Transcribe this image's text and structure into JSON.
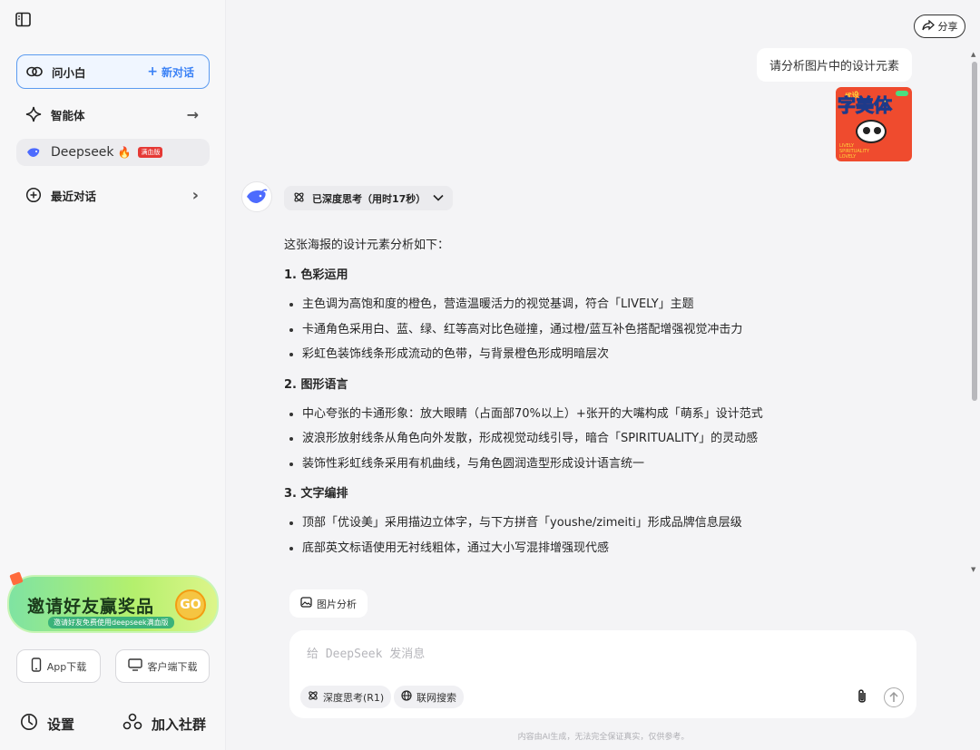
{
  "sidebar": {
    "ask_label": "问小白",
    "new_chat_label": "新对话",
    "agents_label": "智能体",
    "deepseek_label": "Deepseek",
    "deepseek_badge": "满血版",
    "recent_label": "最近对话",
    "promo_title": "邀请好友赢奖品",
    "promo_sub": "邀请好友免费使用deepseek满血版",
    "promo_go": "GO",
    "app_download": "App下载",
    "client_download": "客户端下载",
    "settings_label": "设置",
    "community_label": "加入社群"
  },
  "header": {
    "share_label": "分享"
  },
  "conversation": {
    "user_message": "请分析图片中的设计元素",
    "user_image": {
      "line1": "优设",
      "line2": "字美体",
      "line3": "LIVELY SPIRITUALITY LOVELY"
    },
    "think_label": "已深度思考（用时17秒）",
    "intro": "这张海报的设计元素分析如下：",
    "sections": [
      {
        "title": "1. 色彩运用",
        "items": [
          "主色调为高饱和度的橙色，营造温暖活力的视觉基调，符合「LIVELY」主题",
          "卡通角色采用白、蓝、绿、红等高对比色碰撞，通过橙/蓝互补色搭配增强视觉冲击力",
          "彩虹色装饰线条形成流动的色带，与背景橙色形成明暗层次"
        ]
      },
      {
        "title": "2. 图形语言",
        "items": [
          "中心夸张的卡通形象：放大眼睛（占面部70%以上）+张开的大嘴构成「萌系」设计范式",
          "波浪形放射线条从角色向外发散，形成视觉动线引导，暗合「SPIRITUALITY」的灵动感",
          "装饰性彩虹线条采用有机曲线，与角色圆润造型形成设计语言统一"
        ]
      },
      {
        "title": "3. 文字编排",
        "items": [
          "顶部「优设美」采用描边立体字，与下方拼音「youshe/zimeiti」形成品牌信息层级",
          "底部英文标语使用无衬线粗体，通过大小写混排增强现代感"
        ]
      }
    ]
  },
  "composer": {
    "chip_label": "图片分析",
    "placeholder": "给 DeepSeek 发消息",
    "deep_think_label": "深度思考(R1)",
    "web_search_label": "联网搜索"
  },
  "footer": {
    "disclaimer": "内容由AI生成，无法完全保证真实，仅供参考。"
  },
  "colors": {
    "accent": "#3b82f6",
    "active_border": "#5b9bf0",
    "promo_green": "#7fe3a2",
    "poster_orange": "#ef4b2e"
  }
}
